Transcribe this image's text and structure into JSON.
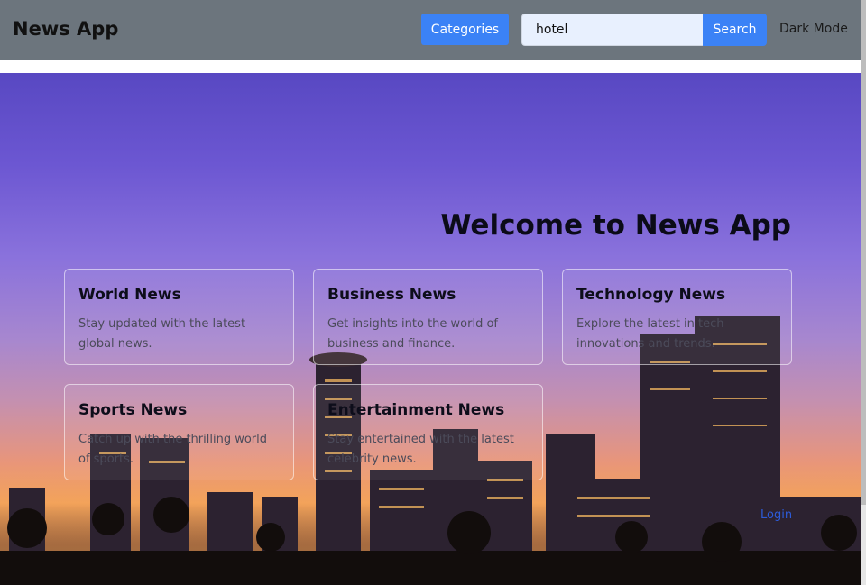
{
  "navbar": {
    "brand": "News App",
    "categories_label": "Categories",
    "search_value": "hotel",
    "search_label": "Search",
    "dark_mode_label": "Dark Mode"
  },
  "hero": {
    "title": "Welcome to News App",
    "cards": [
      {
        "title": "World News",
        "text": "Stay updated with the latest global news."
      },
      {
        "title": "Business News",
        "text": "Get insights into the world of business and finance."
      },
      {
        "title": "Technology News",
        "text": "Explore the latest in tech innovations and trends."
      },
      {
        "title": "Sports News",
        "text": "Catch up with the thrilling world of sports."
      },
      {
        "title": "Entertainment News",
        "text": "Stay entertained with the latest celebrity news."
      }
    ],
    "login_label": "Login"
  },
  "colors": {
    "navbar_bg": "#6c757d",
    "accent": "#3b82f6",
    "login_link": "#2d5bd8"
  }
}
